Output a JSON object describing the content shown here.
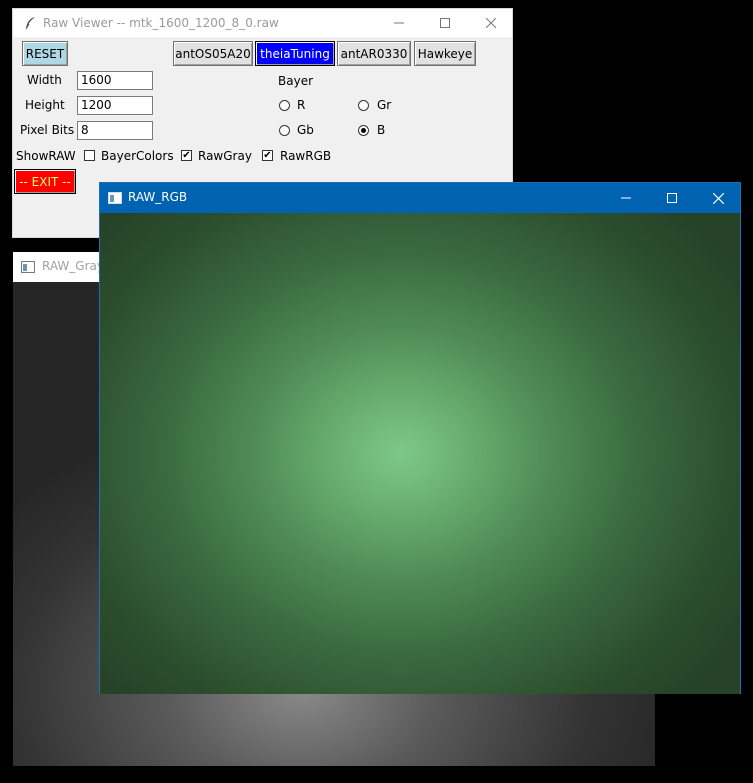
{
  "main_window": {
    "title": "Raw Viewer -- mtk_1600_1200_8_0.raw",
    "buttons": {
      "reset": "RESET",
      "presets": [
        "antOS05A20",
        "theiaTuning",
        "antAR0330",
        "Hawkeye"
      ],
      "exit": "-- EXIT --"
    },
    "fields": {
      "width_label": "Width",
      "width_value": "1600",
      "height_label": "Height",
      "height_value": "1200",
      "pixel_bits_label": "Pixel Bits",
      "pixel_bits_value": "8"
    },
    "bayer": {
      "label": "Bayer",
      "options": [
        "R",
        "Gr",
        "Gb",
        "B"
      ],
      "selected": "B"
    },
    "show_raw": {
      "label": "ShowRAW",
      "checks": [
        {
          "label": "BayerColors",
          "checked": false
        },
        {
          "label": "RawGray",
          "checked": true
        },
        {
          "label": "RawRGB",
          "checked": true
        }
      ]
    },
    "colors": {
      "active_preset": "#0000ff",
      "reset_bg": "#add8e6",
      "exit_bg": "#ff0000"
    }
  },
  "gray_window": {
    "title": "RAW_Gray"
  },
  "rgb_window": {
    "title": "RAW_RGB"
  },
  "icons": {
    "app": "feather-icon",
    "window": "window-icon",
    "minimize": "minimize-icon",
    "maximize": "maximize-icon",
    "close": "close-icon"
  }
}
